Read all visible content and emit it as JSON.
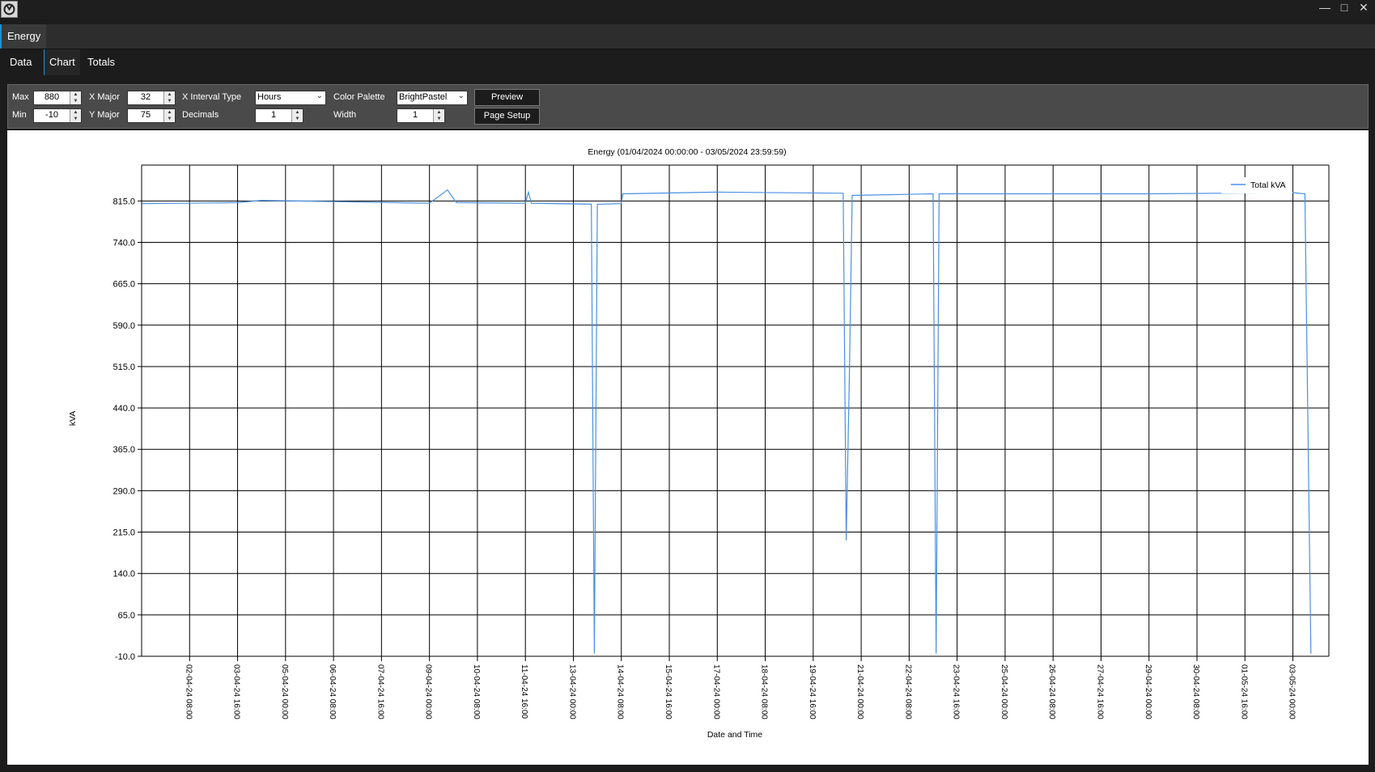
{
  "window": {
    "title": "",
    "controls": [
      "minimize",
      "maximize",
      "close"
    ]
  },
  "doc_tab": {
    "label": "Energy"
  },
  "view_tabs": [
    {
      "label": "Data"
    },
    {
      "label": "Chart",
      "active": true
    },
    {
      "label": "Totals"
    }
  ],
  "toolbar": {
    "max_label": "Max",
    "max_value": "880",
    "min_label": "Min",
    "min_value": "-10",
    "xmajor_label": "X Major",
    "xmajor_value": "32",
    "ymajor_label": "Y Major",
    "ymajor_value": "75",
    "xinterval_label": "X Interval Type",
    "xinterval_value": "Hours",
    "decimals_label": "Decimals",
    "decimals_value": "1",
    "palette_label": "Color Palette",
    "palette_value": "BrightPastel",
    "width_label": "Width",
    "width_value": "1",
    "preview_label": "Preview",
    "pagesetup_label": "Page Setup"
  },
  "chart_data": {
    "type": "line",
    "title": "Energy (01/04/2024 00:00:00 - 03/05/2024 23:59:59)",
    "xlabel": "Date and Time",
    "ylabel": "kVA",
    "ylim": [
      -10,
      880
    ],
    "yticks": [
      "815.0",
      "740.0",
      "665.0",
      "590.0",
      "515.0",
      "440.0",
      "365.0",
      "290.0",
      "215.0",
      "140.0",
      "65.0",
      "-10.0"
    ],
    "ytick_values": [
      815,
      740,
      665,
      590,
      515,
      440,
      365,
      290,
      215,
      140,
      65,
      -10
    ],
    "xlim": [
      "01-04-24 00:00",
      "03-05-24 23:59"
    ],
    "xticks": [
      "02-04-24 08:00",
      "03-04-24 16:00",
      "05-04-24 00:00",
      "06-04-24 08:00",
      "07-04-24 16:00",
      "09-04-24 00:00",
      "10-04-24 08:00",
      "11-04-24 16:00",
      "13-04-24 00:00",
      "14-04-24 08:00",
      "15-04-24 16:00",
      "17-04-24 00:00",
      "18-04-24 08:00",
      "19-04-24 16:00",
      "21-04-24 00:00",
      "22-04-24 08:00",
      "23-04-24 16:00",
      "25-04-24 00:00",
      "26-04-24 08:00",
      "27-04-24 16:00",
      "29-04-24 00:00",
      "30-04-24 08:00",
      "01-05-24 16:00",
      "03-05-24 00:00"
    ],
    "legend_position": "top-right",
    "grid": true,
    "color": "#4a90e2",
    "series": [
      {
        "name": "Total kVA",
        "points": [
          [
            "01-04-24 00:00",
            810
          ],
          [
            "03-04-24 16:00",
            812
          ],
          [
            "04-04-24 08:00",
            816
          ],
          [
            "09-04-24 00:00",
            811
          ],
          [
            "09-04-24 12:00",
            835
          ],
          [
            "09-04-24 18:00",
            812
          ],
          [
            "11-04-24 16:00",
            811
          ],
          [
            "11-04-24 18:00",
            831
          ],
          [
            "11-04-24 20:00",
            811
          ],
          [
            "13-04-24 12:00",
            809
          ],
          [
            "13-04-24 14:00",
            -5
          ],
          [
            "13-04-24 16:00",
            809
          ],
          [
            "14-04-24 08:00",
            810
          ],
          [
            "14-04-24 09:00",
            828
          ],
          [
            "17-04-24 00:00",
            831
          ],
          [
            "20-04-24 12:00",
            829
          ],
          [
            "20-04-24 14:00",
            200
          ],
          [
            "20-04-24 16:00",
            480
          ],
          [
            "20-04-24 18:00",
            825
          ],
          [
            "23-04-24 00:00",
            828
          ],
          [
            "23-04-24 02:00",
            -5
          ],
          [
            "23-04-24 04:00",
            828
          ],
          [
            "29-04-24 00:00",
            828
          ],
          [
            "03-05-24 00:00",
            830
          ],
          [
            "03-05-24 08:00",
            828
          ],
          [
            "03-05-24 12:00",
            -5
          ]
        ]
      }
    ]
  }
}
